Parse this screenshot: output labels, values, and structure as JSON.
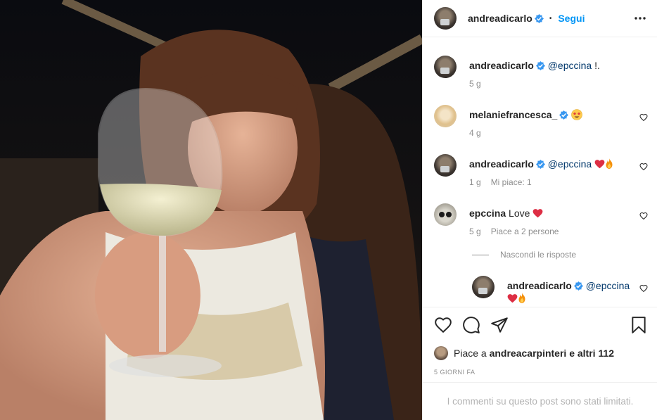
{
  "post": {
    "author": "andreadicarlo",
    "verified": true,
    "separator": "•",
    "follow_label": "Segui",
    "more_icon": "more-options-icon"
  },
  "comments": [
    {
      "user": "andreadicarlo",
      "verified": true,
      "mention": "@epccina",
      "text": "!.",
      "time": "5 g"
    },
    {
      "user": "melaniefrancesca_",
      "verified": true,
      "emoji": "star-struck-emoji",
      "time": "4 g"
    },
    {
      "user": "andreadicarlo",
      "verified": true,
      "mention": "@epccina",
      "emoji": [
        "red-heart-emoji",
        "fire-emoji"
      ],
      "time": "1 g",
      "likes": "Mi piace: 1"
    },
    {
      "user": "epccina",
      "text": "Love",
      "emoji": "red-heart-emoji",
      "time": "5 g",
      "likes": "Piace a 2 persone"
    }
  ],
  "replies_toggle": "Nascondi le risposte",
  "reply": {
    "user": "andreadicarlo",
    "verified": true,
    "mention": "@epccina",
    "emoji": [
      "red-heart-emoji",
      "fire-emoji"
    ]
  },
  "actions": [
    "heart-icon",
    "comment-icon",
    "share-icon",
    "bookmark-icon"
  ],
  "likes_summary": {
    "prefix": "Piace a",
    "user": "andreacarpinteri",
    "suffix": "e altri 112"
  },
  "date_label": "5 GIORNI FA",
  "comments_limited": "I commenti su questo post sono stati limitati.",
  "colors": {
    "accent": "#0095f6",
    "mention": "#00376b",
    "muted": "#8e8e8e",
    "heart": "#ed4956"
  }
}
